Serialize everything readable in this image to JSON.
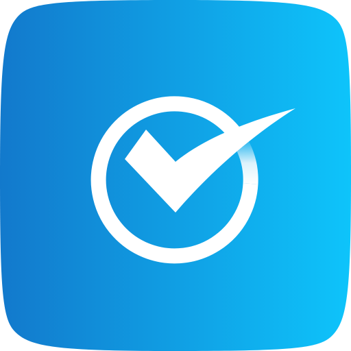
{
  "app_icon": {
    "icon_name": "checkmark-circle-icon",
    "colors": {
      "gradient_start": "#1279cc",
      "gradient_end": "#0ec4fb",
      "glyph": "#ffffff",
      "ring_highlight": "#d8f1fb"
    }
  }
}
